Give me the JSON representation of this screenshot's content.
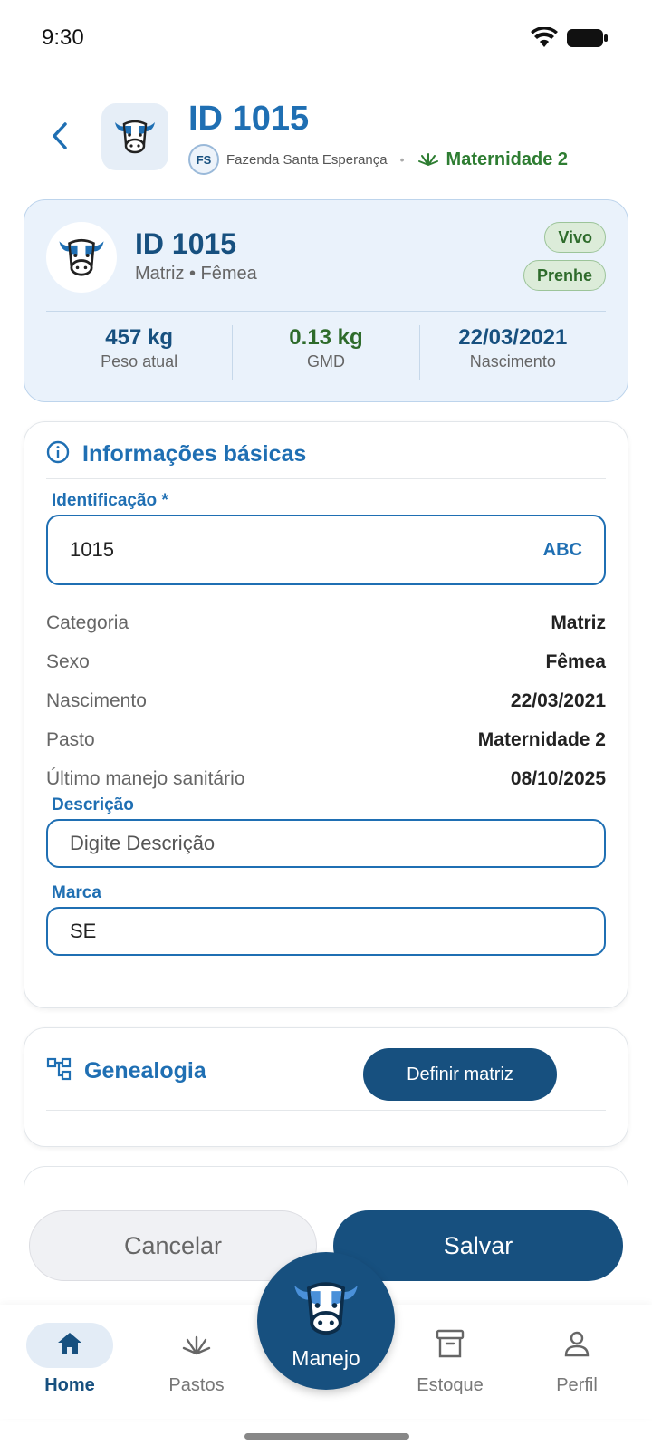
{
  "status": {
    "time": "9:30"
  },
  "header": {
    "title": "ID 1015",
    "farm_initials": "FS",
    "farm_name": "Fazenda Santa Esperança",
    "separator": "•",
    "pasture": "Maternidade 2"
  },
  "summary": {
    "id": "ID 1015",
    "subtitle": "Matriz • Fêmea",
    "chips": [
      "Vivo",
      "Prenhe"
    ],
    "stats": [
      {
        "value": "457 kg",
        "label": "Peso atual"
      },
      {
        "value": "0.13 kg",
        "label": "GMD"
      },
      {
        "value": "22/03/2021",
        "label": "Nascimento"
      }
    ]
  },
  "basic_info": {
    "title": "Informações básicas",
    "identification_label": "Identificação *",
    "identification_value": "1015",
    "identification_suffix": "ABC",
    "rows": [
      {
        "key": "Categoria",
        "value": "Matriz"
      },
      {
        "key": "Sexo",
        "value": "Fêmea"
      },
      {
        "key": "Nascimento",
        "value": "22/03/2021"
      },
      {
        "key": "Pasto",
        "value": "Maternidade 2"
      },
      {
        "key": "Último manejo sanitário",
        "value": "08/10/2025"
      }
    ],
    "description_label": "Descrição",
    "description_placeholder": "Digite Descrição",
    "brand_label": "Marca",
    "brand_value": "SE"
  },
  "genealogy": {
    "title": "Genealogia",
    "define_button": "Definir matriz"
  },
  "actions": {
    "cancel": "Cancelar",
    "save": "Salvar"
  },
  "nav": {
    "items": [
      "Home",
      "Pastos",
      "Estoque",
      "Perfil"
    ],
    "center": "Manejo"
  },
  "colors": {
    "primary": "#17507f",
    "accent_blue": "#1f6fb3",
    "green": "#2e7d32",
    "card_bg": "#eaf2fb"
  }
}
